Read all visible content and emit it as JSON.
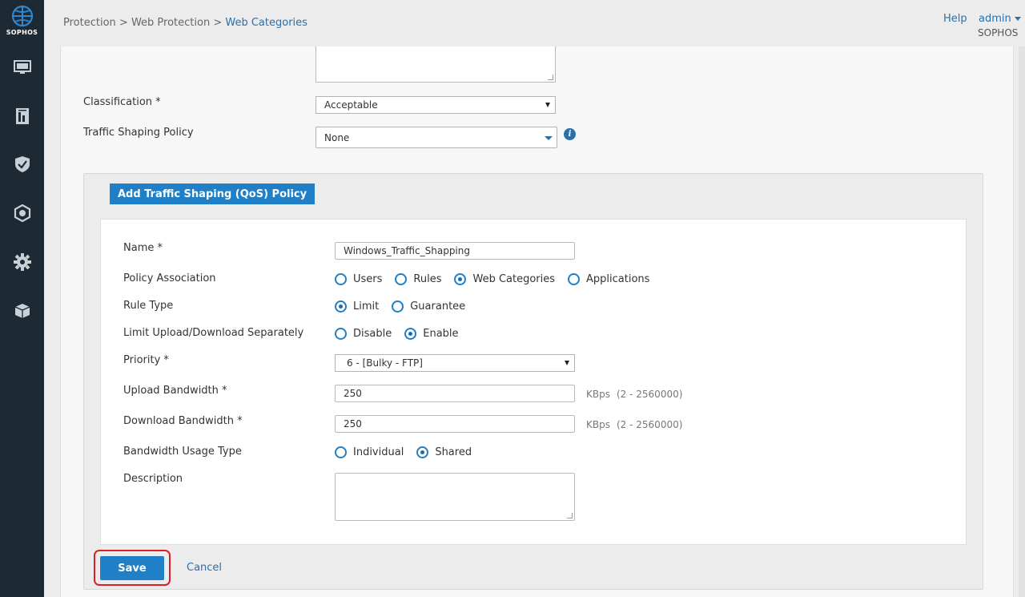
{
  "app": {
    "logo_text": "SOPHOS"
  },
  "header": {
    "breadcrumb": {
      "part1": "Protection",
      "sep1": " > ",
      "part2": "Web Protection",
      "sep2": " > ",
      "current": "Web Categories"
    },
    "help_label": "Help",
    "admin_label": "admin",
    "org_label": "SOPHOS"
  },
  "sidebar": {
    "items": [
      {
        "icon": "monitor-icon"
      },
      {
        "icon": "report-icon"
      },
      {
        "icon": "shield-check-icon"
      },
      {
        "icon": "protection-icon"
      },
      {
        "icon": "gear-icon"
      },
      {
        "icon": "box-icon"
      }
    ]
  },
  "form": {
    "classification_label": "Classification *",
    "classification_value": "Acceptable",
    "traffic_shaping_label": "Traffic Shaping Policy",
    "traffic_shaping_value": "None"
  },
  "qos": {
    "title": "Add Traffic Shaping (QoS) Policy",
    "name_label": "Name *",
    "name_value": "Windows_Traffic_Shapping",
    "association_label": "Policy Association",
    "association_options": [
      "Users",
      "Rules",
      "Web Categories",
      "Applications"
    ],
    "association_selected": "Web Categories",
    "rule_type_label": "Rule Type",
    "rule_type_options": [
      "Limit",
      "Guarantee"
    ],
    "rule_type_selected": "Limit",
    "limit_sep_label": "Limit Upload/Download Separately",
    "limit_sep_options": [
      "Disable",
      "Enable"
    ],
    "limit_sep_selected": "Enable",
    "priority_label": "Priority *",
    "priority_value": "6 - [Bulky - FTP]",
    "upload_label": "Upload Bandwidth *",
    "upload_value": "250",
    "upload_unit": "KBps",
    "upload_range": "(2 - 2560000)",
    "download_label": "Download Bandwidth *",
    "download_value": "250",
    "download_unit": "KBps",
    "download_range": "(2 - 2560000)",
    "usage_label": "Bandwidth Usage Type",
    "usage_options": [
      "Individual",
      "Shared"
    ],
    "usage_selected": "Shared",
    "description_label": "Description",
    "description_value": ""
  },
  "actions": {
    "save_label": "Save",
    "cancel_label": "Cancel"
  },
  "colors": {
    "accent": "#1f7fc7",
    "sidebar_bg": "#1e2a33",
    "highlight": "#d9202a"
  }
}
